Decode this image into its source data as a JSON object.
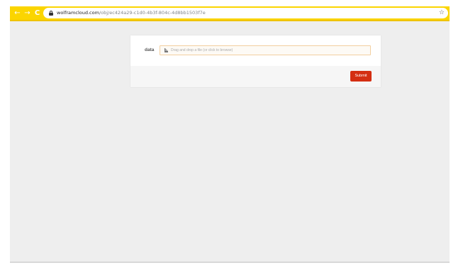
{
  "browser": {
    "nav": {
      "back_icon": "←",
      "forward_icon": "→",
      "reload_icon": "C"
    },
    "address": {
      "host": "wolframcloud.com",
      "path": "/obj/ec424a29-c1d0-4b3f-804c-4d8bb1503f7e"
    },
    "bookmark_icon": "☆",
    "toolbar_color": "#fbd500"
  },
  "form": {
    "field": {
      "label": "data",
      "placeholder": "Drag and drop a file (or click to browse)"
    },
    "submit_label": "Submit",
    "submit_color": "#d42e12"
  }
}
